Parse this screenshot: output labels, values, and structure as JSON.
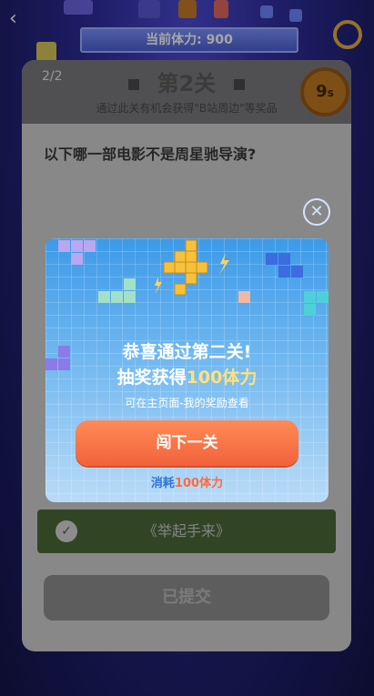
{
  "header": {
    "stamina_label": "当前体力:",
    "stamina_value": "900"
  },
  "card": {
    "progress": "2/2",
    "level_title": "第2关",
    "subtitle": "通过此关有机会获得\"B站周边\"等奖品",
    "timer_value": "9",
    "timer_unit": "s",
    "question": "以下哪一部电影不是周星驰导演?",
    "correct_answer": "《举起手来》",
    "submit_label": "已提交"
  },
  "modal": {
    "line1": "恭喜通过第二关!",
    "line2_prefix": "抽奖获得",
    "line2_highlight": "100体力",
    "note": "可在主页面-我的奖励查看",
    "next_button": "闯下一关",
    "cost_prefix": "消耗",
    "cost_highlight": "100体力"
  },
  "colors": {
    "primary_button": "#f2633b",
    "modal_sky": "#3c9ae8",
    "highlight": "#ffe27a"
  },
  "icons": [
    "back-icon",
    "timer-icon",
    "check-icon",
    "close-icon",
    "lightning-icon",
    "tetris-block-icon"
  ]
}
